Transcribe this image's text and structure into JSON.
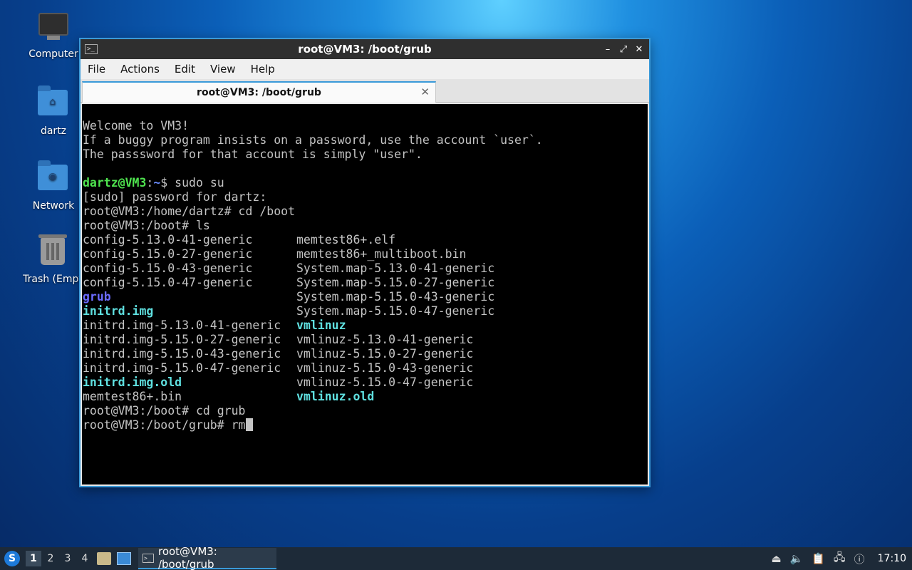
{
  "desktop": {
    "icons": [
      {
        "label": "Computer",
        "glyph": "computer-icon"
      },
      {
        "label": "dartz",
        "glyph": "home-folder-icon"
      },
      {
        "label": "Network",
        "glyph": "network-folder-icon"
      },
      {
        "label": "Trash (Empt",
        "glyph": "trash-icon"
      }
    ]
  },
  "window": {
    "title": "root@VM3: /boot/grub",
    "controls": {
      "minimize": "–",
      "maximize": "⤢",
      "close": "✕"
    },
    "menu": [
      "File",
      "Actions",
      "Edit",
      "View",
      "Help"
    ],
    "tab": {
      "label": "root@VM3: /boot/grub",
      "close": "✕"
    }
  },
  "terminal": {
    "welcome": [
      "Welcome to VM3!",
      "If a buggy program insists on a password, use the account `user`.",
      "The passsword for that account is simply \"user\"."
    ],
    "prompt_user": "dartz@VM3",
    "prompt_sep": ":",
    "prompt_path": "~",
    "prompt_end": "$ ",
    "cmd1": "sudo su",
    "sudo_line": "[sudo] password for dartz:",
    "line_cd_boot": "root@VM3:/home/dartz# cd /boot",
    "line_ls": "root@VM3:/boot# ls",
    "ls_rows": [
      [
        {
          "t": "config-5.13.0-41-generic",
          "c": ""
        },
        {
          "t": "memtest86+.elf",
          "c": ""
        }
      ],
      [
        {
          "t": "config-5.15.0-27-generic",
          "c": ""
        },
        {
          "t": "memtest86+_multiboot.bin",
          "c": ""
        }
      ],
      [
        {
          "t": "config-5.15.0-43-generic",
          "c": ""
        },
        {
          "t": "System.map-5.13.0-41-generic",
          "c": ""
        }
      ],
      [
        {
          "t": "config-5.15.0-47-generic",
          "c": ""
        },
        {
          "t": "System.map-5.15.0-27-generic",
          "c": ""
        }
      ],
      [
        {
          "t": "grub",
          "c": "purple"
        },
        {
          "t": "System.map-5.15.0-43-generic",
          "c": ""
        }
      ],
      [
        {
          "t": "initrd.img",
          "c": "cyan"
        },
        {
          "t": "System.map-5.15.0-47-generic",
          "c": ""
        }
      ],
      [
        {
          "t": "initrd.img-5.13.0-41-generic",
          "c": ""
        },
        {
          "t": "vmlinuz",
          "c": "cyan"
        }
      ],
      [
        {
          "t": "initrd.img-5.15.0-27-generic",
          "c": ""
        },
        {
          "t": "vmlinuz-5.13.0-41-generic",
          "c": ""
        }
      ],
      [
        {
          "t": "initrd.img-5.15.0-43-generic",
          "c": ""
        },
        {
          "t": "vmlinuz-5.15.0-27-generic",
          "c": ""
        }
      ],
      [
        {
          "t": "initrd.img-5.15.0-47-generic",
          "c": ""
        },
        {
          "t": "vmlinuz-5.15.0-43-generic",
          "c": ""
        }
      ],
      [
        {
          "t": "initrd.img.old",
          "c": "cyan"
        },
        {
          "t": "vmlinuz-5.15.0-47-generic",
          "c": ""
        }
      ],
      [
        {
          "t": "memtest86+.bin",
          "c": ""
        },
        {
          "t": "vmlinuz.old",
          "c": "cyan"
        }
      ]
    ],
    "line_cd_grub": "root@VM3:/boot# cd grub",
    "current_prompt": "root@VM3:/boot/grub# ",
    "current_input": "rm"
  },
  "taskbar": {
    "start": "S",
    "workspaces": [
      "1",
      "2",
      "3",
      "4"
    ],
    "active_workspace": "1",
    "task_label": "root@VM3: /boot/grub",
    "clock": "17:10"
  }
}
